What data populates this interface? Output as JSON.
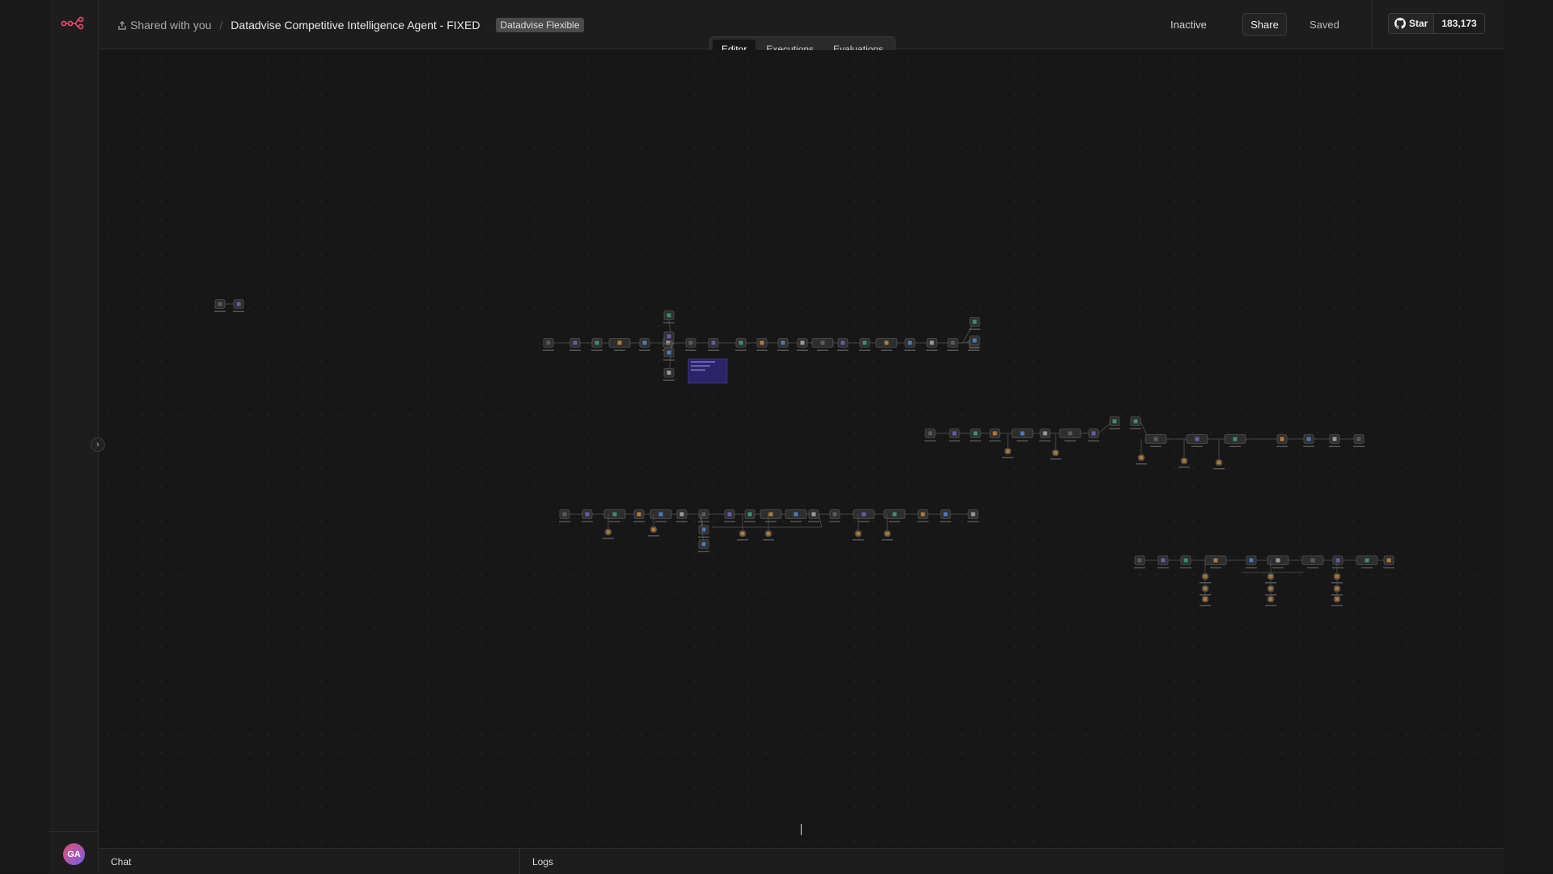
{
  "sidebar": {
    "avatar_initials": "GA",
    "logo_icon": "n8n-logo-icon"
  },
  "header": {
    "shared_label": "Shared with you",
    "workflow_title": "Datadvise Competitive Intelligence Agent - FIXED",
    "tag": "Datadvise Flexible",
    "status": "Inactive",
    "share_label": "Share",
    "saved_label": "Saved",
    "github_star_label": "Star",
    "github_star_count": "183,173"
  },
  "tabs": [
    {
      "label": "Editor",
      "active": true
    },
    {
      "label": "Executions",
      "active": false
    },
    {
      "label": "Evaluations",
      "active": false
    }
  ],
  "bottom_panel": {
    "chat_label": "Chat",
    "logs_label": "Logs"
  },
  "colors": {
    "accent": "#ea4b71",
    "sticky_note": "#2b2468",
    "node_bg": "#2e2e2e"
  }
}
